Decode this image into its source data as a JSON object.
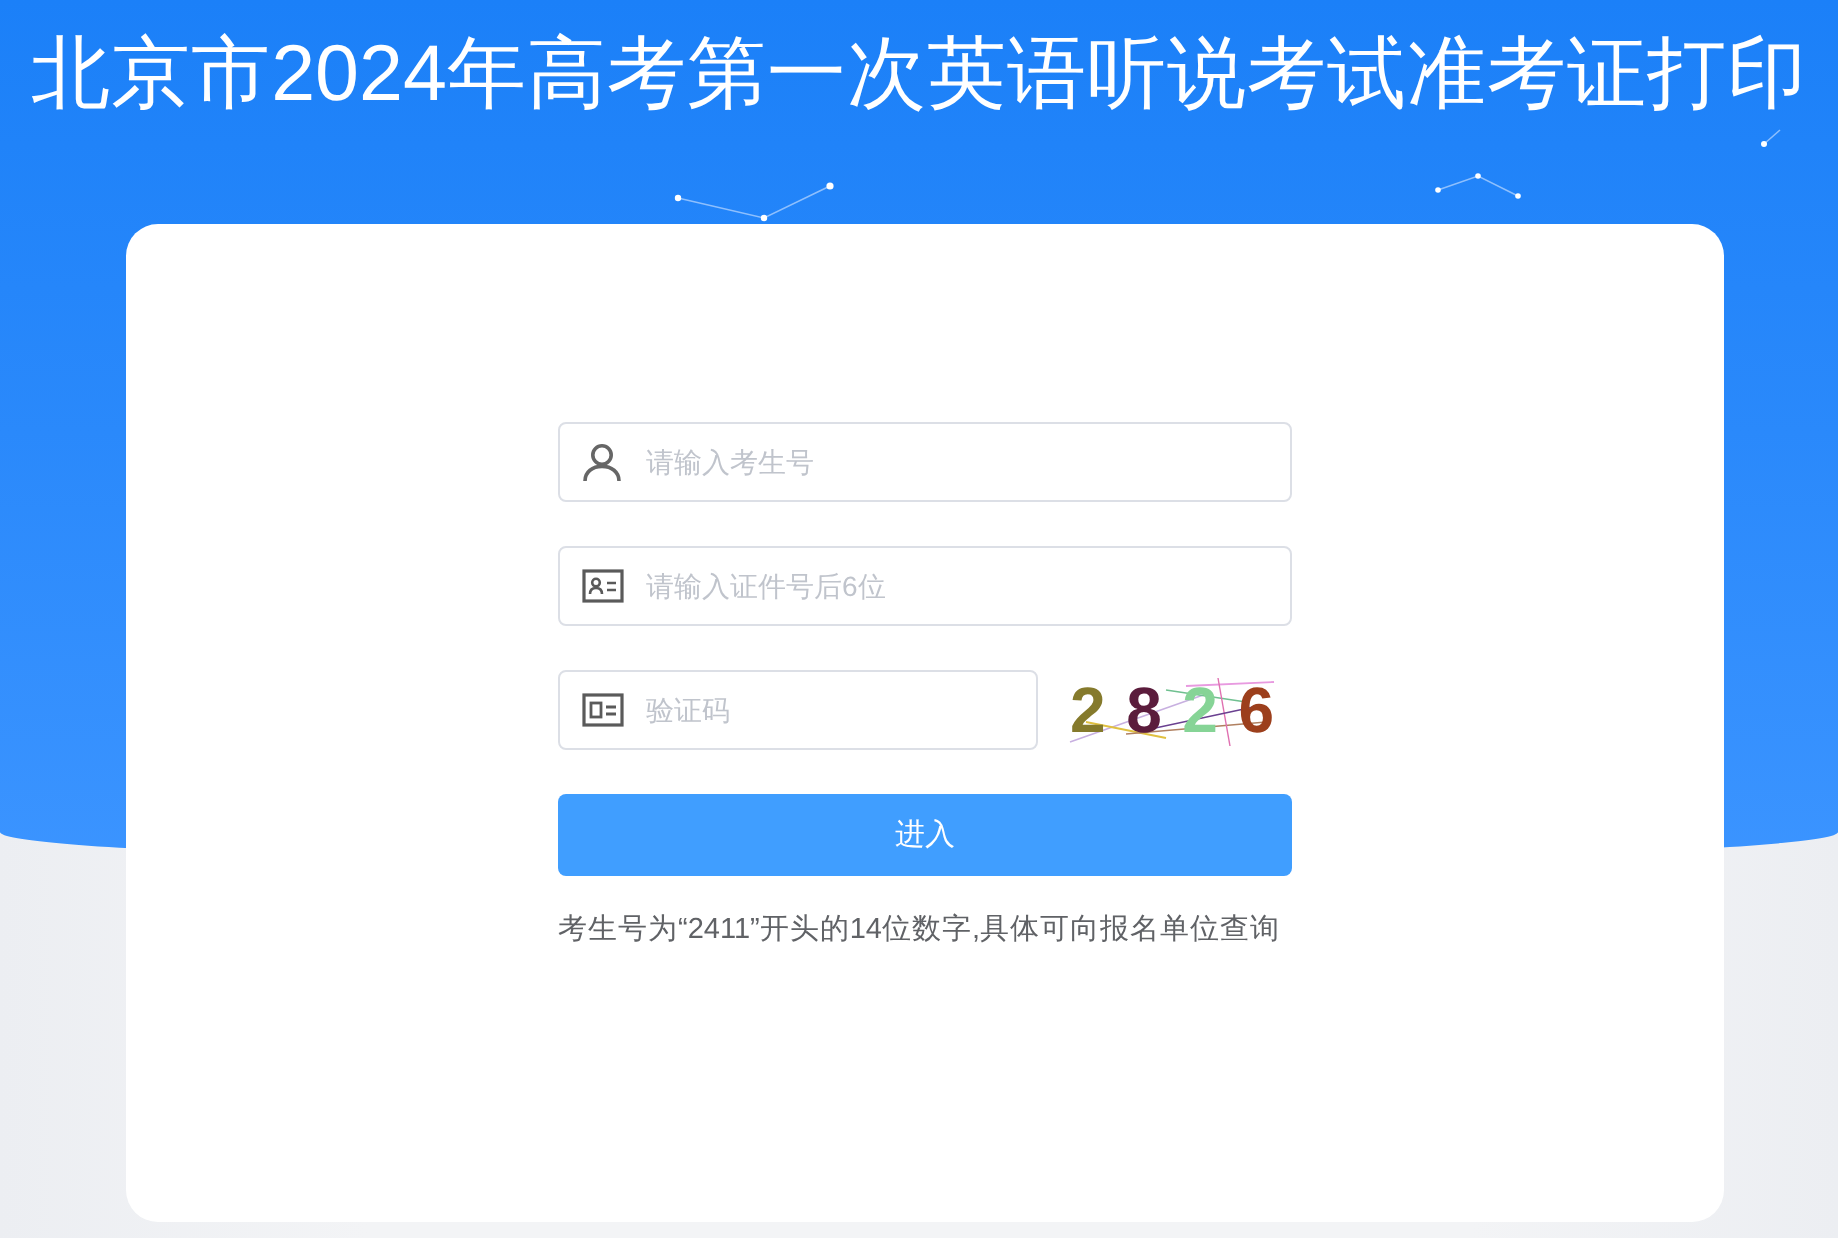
{
  "page": {
    "title": "北京市2024年高考第一次英语听说考试准考证打印"
  },
  "login_form": {
    "fields": [
      {
        "kind": "candidate_number",
        "placeholder": "请输入考生号"
      },
      {
        "kind": "id_number",
        "placeholder": "请输入证件号后6位"
      },
      {
        "kind": "captcha",
        "placeholder": "验证码"
      }
    ],
    "captcha": {
      "digits": [
        {
          "text": "2",
          "color": "#857a2c"
        },
        {
          "text": "8",
          "color": "#5b1c3c"
        },
        {
          "text": "2",
          "color": "#86d496"
        },
        {
          "text": "6",
          "color": "#9c3f1c"
        }
      ]
    },
    "submit_button": "进入",
    "hint": "考生号为“2411”开头的14位数字,具体可向报名单位查询"
  }
}
